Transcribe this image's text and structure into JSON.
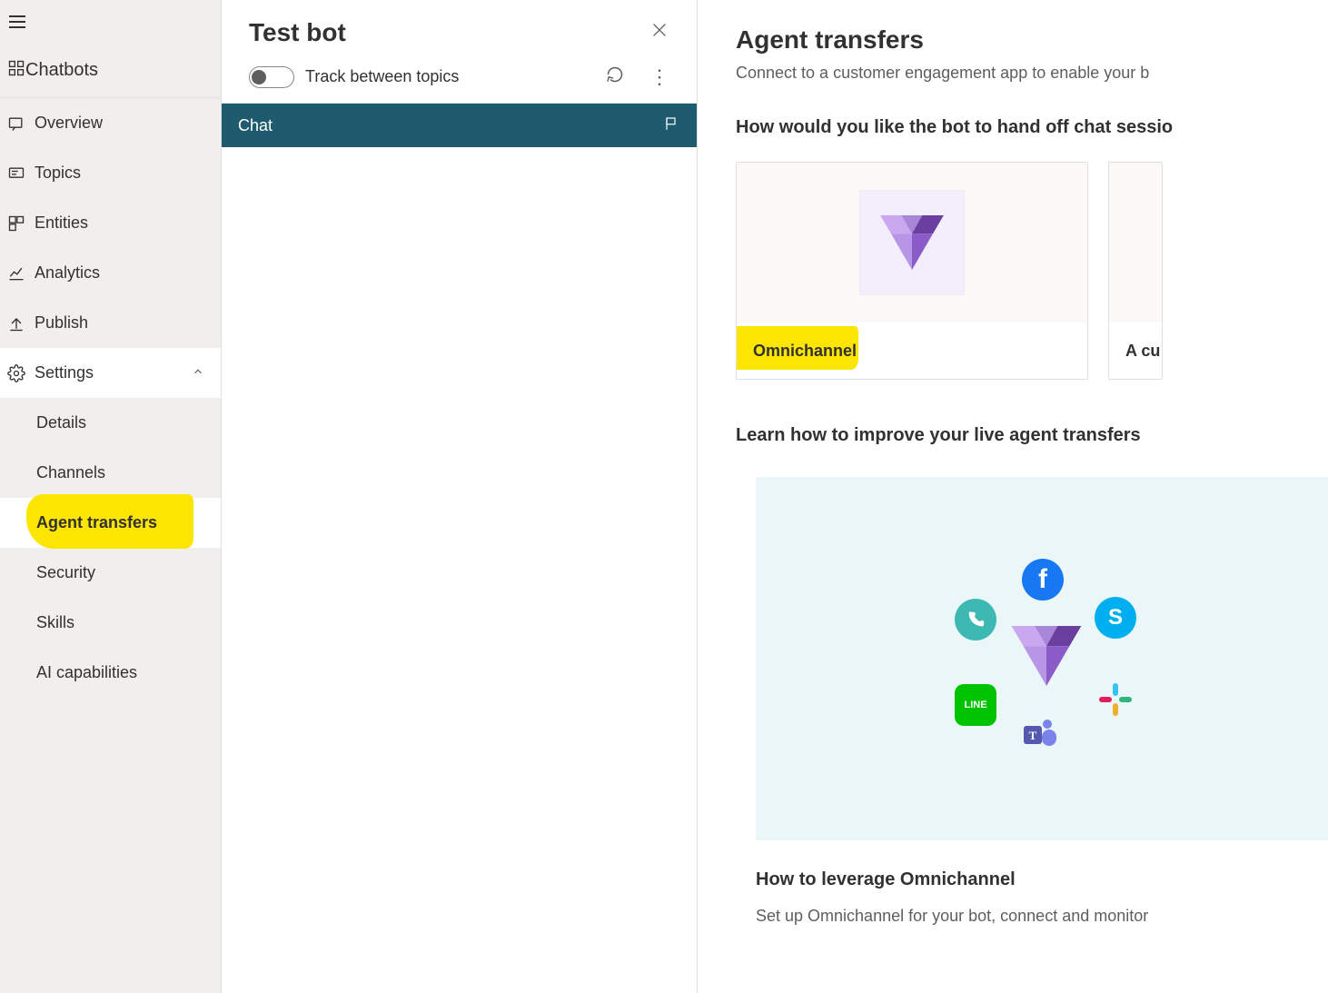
{
  "sidebar": {
    "chatbots_label": "Chatbots",
    "items": [
      {
        "label": "Overview"
      },
      {
        "label": "Topics"
      },
      {
        "label": "Entities"
      },
      {
        "label": "Analytics"
      },
      {
        "label": "Publish"
      }
    ],
    "settings_label": "Settings",
    "settings_children": [
      {
        "label": "Details"
      },
      {
        "label": "Channels"
      },
      {
        "label": "Agent transfers"
      },
      {
        "label": "Security"
      },
      {
        "label": "Skills"
      },
      {
        "label": "AI capabilities"
      }
    ]
  },
  "testbot": {
    "title": "Test bot",
    "track_label": "Track between topics",
    "chat_tab": "Chat"
  },
  "content": {
    "title": "Agent transfers",
    "subtitle": "Connect to a customer engagement app to enable your b",
    "handoff_heading": "How would you like the bot to hand off chat sessio",
    "card_omnichannel": "Omnichannel",
    "card_custom": "A cu",
    "learn_heading": "Learn how to improve your live agent transfers",
    "learn_card_title": "How to leverage Omnichannel",
    "learn_card_body": "Set up Omnichannel for your bot, connect and monitor"
  }
}
